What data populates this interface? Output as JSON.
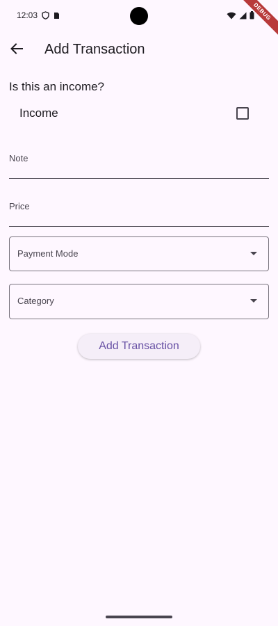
{
  "status_bar": {
    "time": "12:03",
    "icons": [
      "shield-icon",
      "sim-card-icon",
      "wifi-icon",
      "signal-icon",
      "battery-icon"
    ]
  },
  "debug_banner": "DEBUG",
  "app_bar": {
    "title": "Add Transaction",
    "back_icon": "arrow-back-icon"
  },
  "form": {
    "question": "Is this an income?",
    "income_label": "Income",
    "income_checked": false,
    "note_label": "Note",
    "price_label": "Price",
    "payment_mode_label": "Payment Mode",
    "category_label": "Category",
    "submit_label": "Add Transaction"
  },
  "colors": {
    "background": "#fef7ff",
    "primary": "#6750a4",
    "button_surface": "#f5eef8",
    "outline": "#79747e",
    "on_surface": "#1d1b20",
    "debug": "#b83a3a"
  }
}
